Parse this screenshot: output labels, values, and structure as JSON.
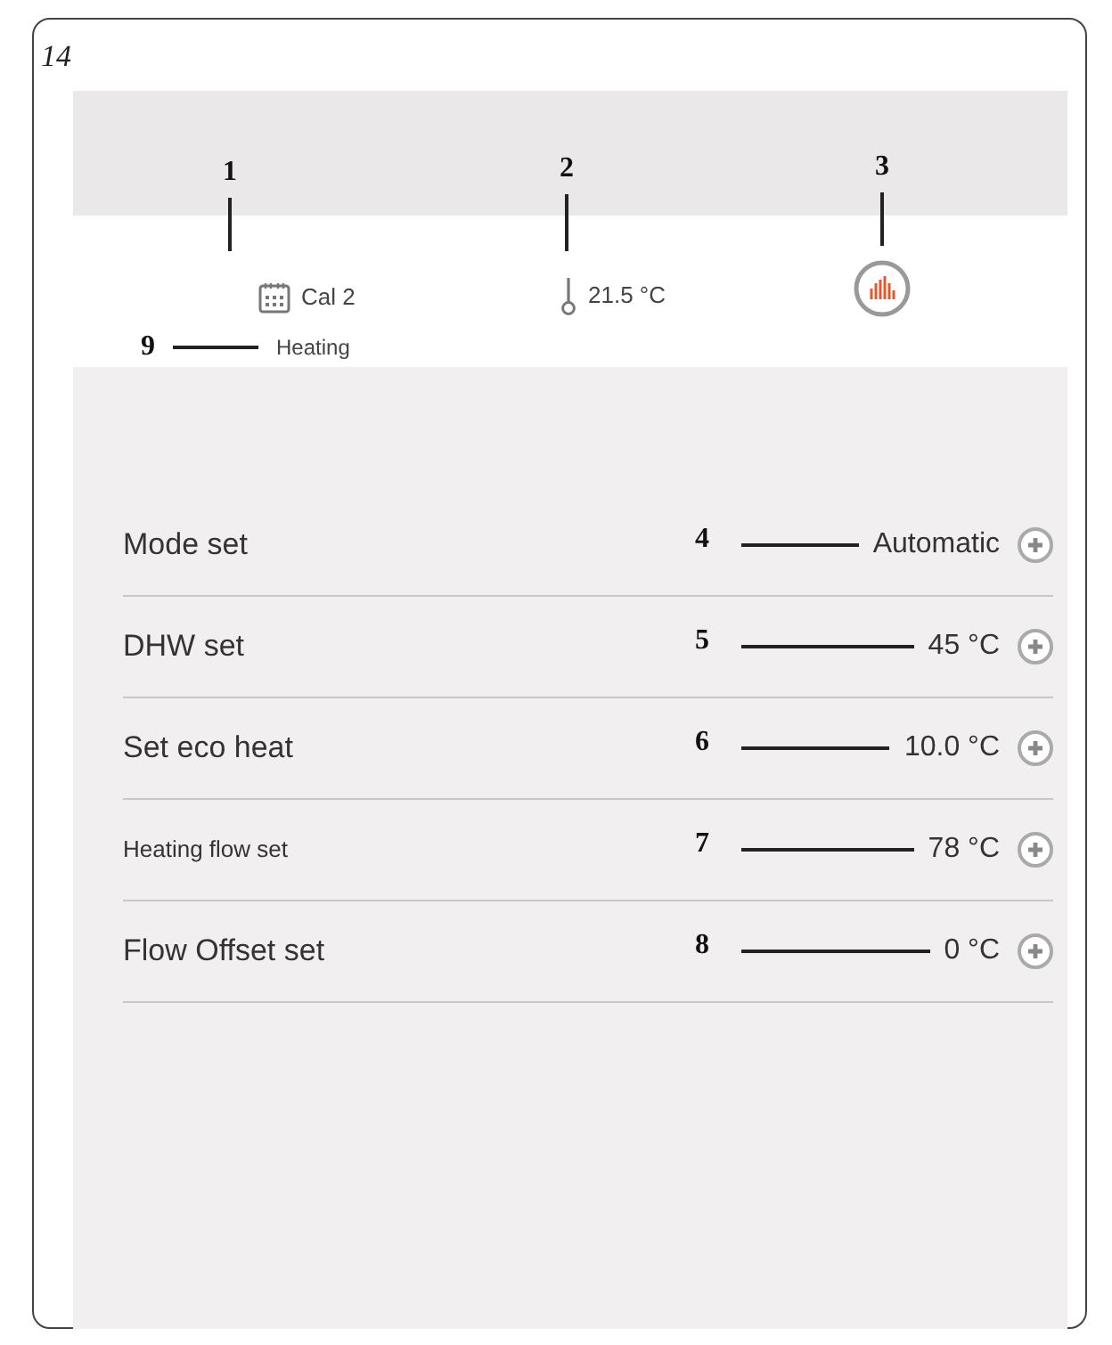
{
  "page_number": "14",
  "header": {
    "calendar": {
      "callout": "1",
      "label": "Cal 2"
    },
    "temperature": {
      "callout": "2",
      "reading": "21.5 °C"
    },
    "heating_status": {
      "callout": "3"
    },
    "mode": {
      "callout": "9",
      "label": "Heating"
    }
  },
  "settings": [
    {
      "callout": "4",
      "label": "Mode set",
      "value": "Automatic",
      "kind": "standard"
    },
    {
      "callout": "5",
      "label": "DHW set",
      "value": "45 °C",
      "kind": "standard"
    },
    {
      "callout": "6",
      "label": "Set eco heat",
      "value": "10.0 °C",
      "kind": "standard"
    },
    {
      "callout": "7",
      "label": "Heating flow set",
      "value": "78 °C",
      "kind": "compact"
    },
    {
      "callout": "8",
      "label": "Flow Offset set",
      "value": "0 °C",
      "kind": "standard"
    }
  ]
}
